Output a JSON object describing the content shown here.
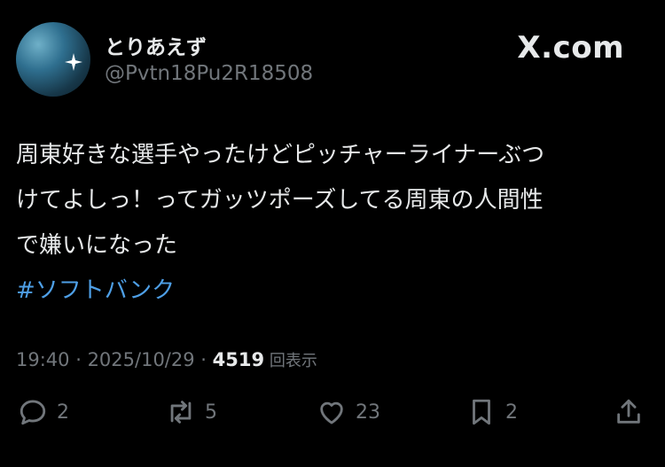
{
  "user": {
    "display_name": "とりあえず",
    "handle": "@Pvtn18Pu2R18508"
  },
  "brand": "X.com",
  "tweet": {
    "lines": [
      "周東好きな選手やったけどピッチャーライナーぶつ",
      "けてよしっ！ってガッツポーズしてる周東の人間性",
      "で嫌いになった"
    ],
    "hashtag": "#ソフトバンク"
  },
  "meta": {
    "time": "19:40",
    "sep1": " · ",
    "date": "2025/10/29",
    "sep2": " · ",
    "views": "4519",
    "views_suffix": " 回表示"
  },
  "actions": {
    "reply": {
      "icon": "reply-icon",
      "count": "2"
    },
    "repost": {
      "icon": "repost-icon",
      "count": "5"
    },
    "like": {
      "icon": "heart-icon",
      "count": "23"
    },
    "bookmark": {
      "icon": "bookmark-icon",
      "count": "2"
    },
    "share": {
      "icon": "share-icon"
    }
  },
  "colors": {
    "background": "#000000",
    "text": "#e7e9ea",
    "secondary": "#71767b",
    "link": "#4e9fe6"
  }
}
